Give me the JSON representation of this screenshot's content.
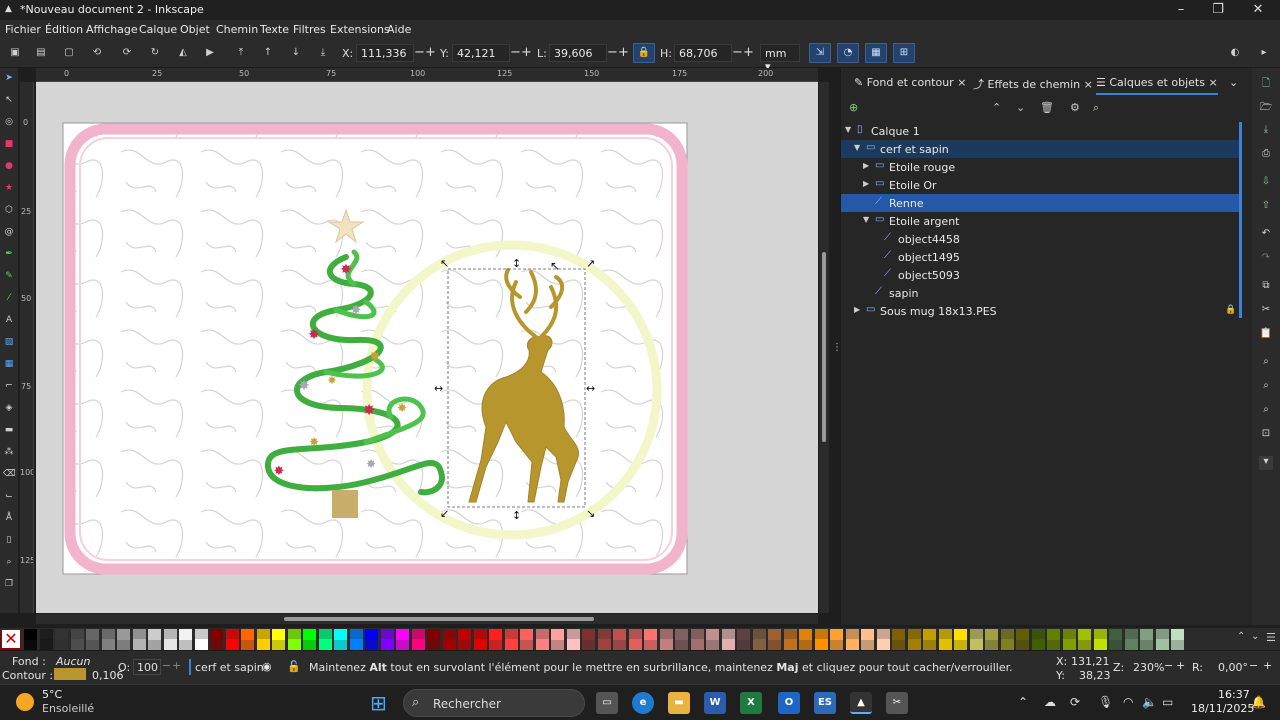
{
  "window": {
    "title": "*Nouveau document 2 - Inkscape"
  },
  "menu": [
    "Fichier",
    "Édition",
    "Affichage",
    "Calque",
    "Objet",
    "Chemin",
    "Texte",
    "Filtres",
    "Extensions",
    "Aide"
  ],
  "toolbar": {
    "x_label": "X:",
    "x_value": "111,336",
    "y_label": "Y:",
    "y_value": "42,121",
    "w_label": "L:",
    "w_value": "39,606",
    "h_label": "H:",
    "h_value": "68,706",
    "unit": "mm",
    "minus": "−",
    "plus": "+"
  },
  "ruler": {
    "h_labels": [
      "0",
      "25",
      "50",
      "75",
      "100",
      "125",
      "150",
      "175",
      "200"
    ],
    "v_labels": [
      "0",
      "25",
      "50",
      "75",
      "100",
      "125"
    ]
  },
  "panel": {
    "tabs": [
      "Fond et contour",
      "Effets de chemin",
      "Calques et objets"
    ],
    "tab_close": "×",
    "layers": [
      {
        "label": "Calque 1",
        "depth": 0,
        "expanded": true,
        "kind": "layer"
      },
      {
        "label": "cerf et sapin",
        "depth": 1,
        "expanded": true,
        "kind": "group",
        "selected": "dark"
      },
      {
        "label": "Etoile rouge",
        "depth": 2,
        "expanded": false,
        "kind": "group"
      },
      {
        "label": "Etoile Or",
        "depth": 2,
        "expanded": false,
        "kind": "group"
      },
      {
        "label": "Renne",
        "depth": 2,
        "kind": "path",
        "selected": "bright"
      },
      {
        "label": "Etoile argent",
        "depth": 2,
        "expanded": true,
        "kind": "group"
      },
      {
        "label": "object4458",
        "depth": 3,
        "kind": "path"
      },
      {
        "label": "object1495",
        "depth": 3,
        "kind": "path"
      },
      {
        "label": "object5093",
        "depth": 3,
        "kind": "path"
      },
      {
        "label": "sapin",
        "depth": 2,
        "kind": "path"
      },
      {
        "label": "Sous mug 18x13.PES",
        "depth": 1,
        "expanded": false,
        "kind": "group",
        "locked": true
      }
    ]
  },
  "colors": {
    "accent": "#2459a8",
    "stroke_swatch": "#b8962e",
    "tree_green": "#3fae3f",
    "frame_pink": "#f2b3cc",
    "deer_gold": "#b8962e"
  },
  "palette": [
    "#000000",
    "#1a1a1a",
    "#333333",
    "#4d4d4d",
    "#666666",
    "#808080",
    "#999999",
    "#b3b3b3",
    "#cccccc",
    "#e6e6e6",
    "#f2f2f2",
    "#ffffff",
    "#800000",
    "#ff0000",
    "#ff6600",
    "#ffcc00",
    "#ffff00",
    "#80ff00",
    "#00ff00",
    "#00ff80",
    "#00ffff",
    "#0080ff",
    "#0000ff",
    "#8000ff",
    "#ff00ff",
    "#ff0080",
    "#800000",
    "#a00000",
    "#c00000",
    "#e00000",
    "#ff2020",
    "#ff4040",
    "#ff6060",
    "#ff8080",
    "#ffa0a0",
    "#ffc0c0",
    "#803030",
    "#a04040",
    "#c05050",
    "#e06060",
    "#ff7070",
    "#c08080",
    "#806060",
    "#a07070",
    "#c09090",
    "#e0b0b0",
    "#604040",
    "#806040",
    "#a06030",
    "#c07020",
    "#e08010",
    "#ff9000",
    "#ffa030",
    "#ffb060",
    "#ffc090",
    "#ffd0b0",
    "#806000",
    "#a08000",
    "#c0a000",
    "#e0c000",
    "#ffe000",
    "#c0c060",
    "#a0a040",
    "#808020",
    "#606000",
    "#406000",
    "#608000",
    "#80a000",
    "#a0c000",
    "#c0e000",
    "#406040",
    "#608060",
    "#80a080",
    "#a0c0a0",
    "#c0e0c0"
  ],
  "status": {
    "fill_label": "Fond :",
    "fill_value": "Aucun",
    "stroke_label": "Contour :",
    "stroke_width": "0,106",
    "opacity_label": "O:",
    "opacity_value": "100",
    "layer_name": "cerf et sapin",
    "message_1": "Maintenez ",
    "message_alt": "Alt",
    "message_2": " tout en survolant l'élément pour le mettre en surbrillance, maintenez ",
    "message_maj": "Maj",
    "message_3": " et cliquez pour tout cacher/verrouiller.",
    "cursor_x_label": "X:",
    "cursor_x": "131,21",
    "cursor_y_label": "Y:",
    "cursor_y": "38,23",
    "zoom_label": "Z:",
    "zoom": "230%",
    "rotation_label": "R:",
    "rotation": "0,00°"
  },
  "taskbar": {
    "weather_temp": "5°C",
    "weather_desc": "Ensoleillé",
    "search_placeholder": "Rechercher",
    "time": "16:37",
    "date": "18/11/2025"
  }
}
